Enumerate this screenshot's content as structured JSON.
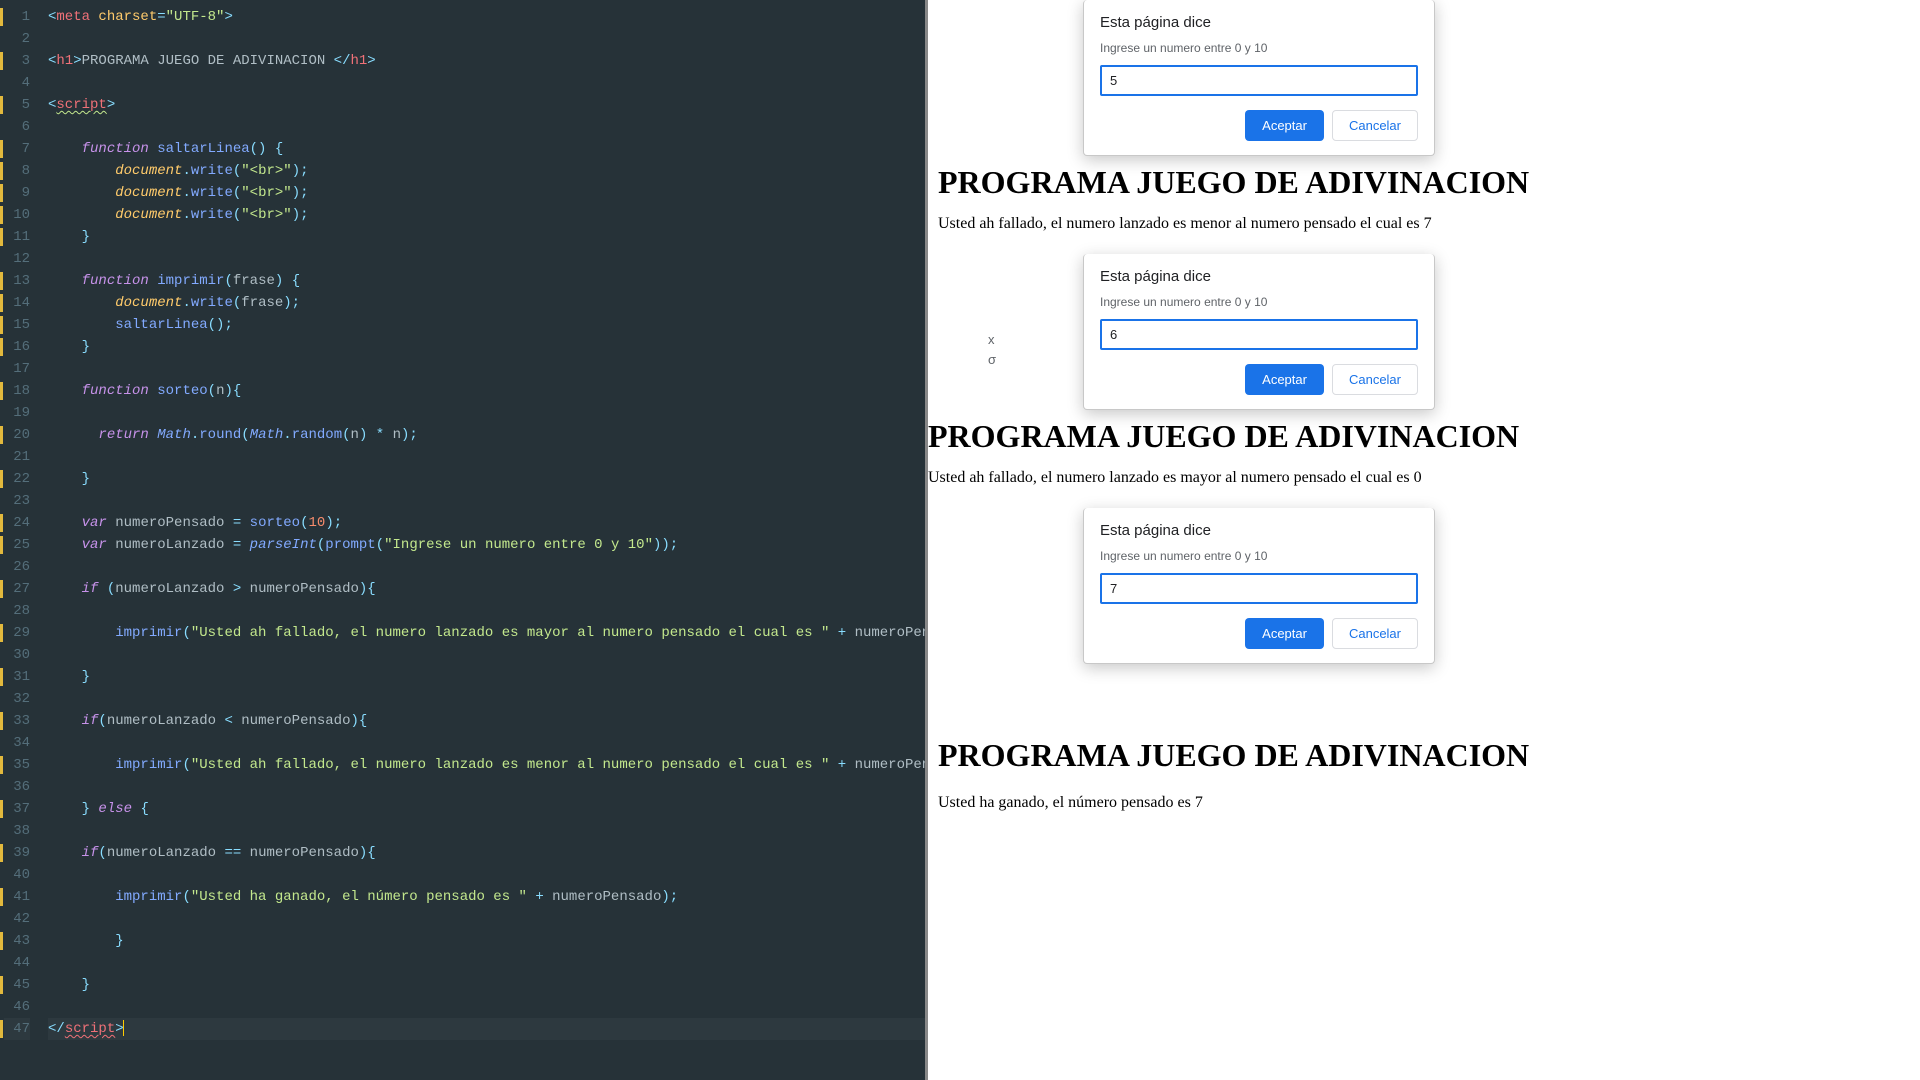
{
  "editor": {
    "lines": [
      1,
      2,
      3,
      4,
      5,
      6,
      7,
      8,
      9,
      10,
      11,
      12,
      13,
      14,
      15,
      16,
      17,
      18,
      19,
      20,
      21,
      22,
      23,
      24,
      25,
      26,
      27,
      28,
      29,
      30,
      31,
      32,
      33,
      34,
      35,
      36,
      37,
      38,
      39,
      40,
      41,
      42,
      43,
      44,
      45,
      46,
      47
    ],
    "modified_lines": [
      1,
      3,
      5,
      7,
      8,
      9,
      10,
      11,
      13,
      14,
      15,
      16,
      18,
      20,
      22,
      24,
      25,
      27,
      29,
      31,
      33,
      35,
      37,
      39,
      41,
      43,
      45,
      47
    ],
    "meta_attr": "charset",
    "meta_val": "\"UTF-8\"",
    "h1_text": "PROGRAMA JUEGO DE ADIVINACION ",
    "script_tag": "script",
    "kw_function": "function",
    "kw_return": "return",
    "kw_var": "var",
    "kw_if": "if",
    "kw_else": "else",
    "fn_saltarLinea": "saltarLinea",
    "fn_imprimir": "imprimir",
    "fn_sorteo": "sorteo",
    "fn_write": "write",
    "fn_round": "round",
    "fn_random": "random",
    "fn_parseInt": "parseInt",
    "fn_prompt": "prompt",
    "obj_document": "document",
    "obj_Math": "Math",
    "param_frase": "frase",
    "param_n": "n",
    "var_numeroPensado": "numeroPensado",
    "var_numeroLanzado": "numeroLanzado",
    "str_br": "\"<br>\"",
    "str_prompt": "\"Ingrese un numero entre 0 y 10\"",
    "str_mayor": "\"Usted ah fallado, el numero lanzado es mayor al numero pensado el cual es \"",
    "str_menor": "\"Usted ah fallado, el numero lanzado es menor al numero pensado el cual es \"",
    "str_ganado": "\"Usted ha ganado, el número pensado es \"",
    "num_10": "10"
  },
  "browser": {
    "dialog_title": "Esta página dice",
    "dialog_message": "Ingrese un numero entre 0 y 10",
    "dialog1_value": "5",
    "dialog2_value": "6",
    "dialog3_value": "7",
    "accept": "Aceptar",
    "cancel": "Cancelar",
    "heading": "PROGRAMA JUEGO DE ADIVINACION",
    "result_menor": "Usted ah fallado, el numero lanzado es menor al numero pensado el cual es 7",
    "result_mayor": "Usted ah fallado, el numero lanzado es mayor al numero pensado el cual es 0",
    "result_ganado": "Usted ha ganado, el número pensado es 7",
    "stray1": "x",
    "stray2": "σ"
  }
}
